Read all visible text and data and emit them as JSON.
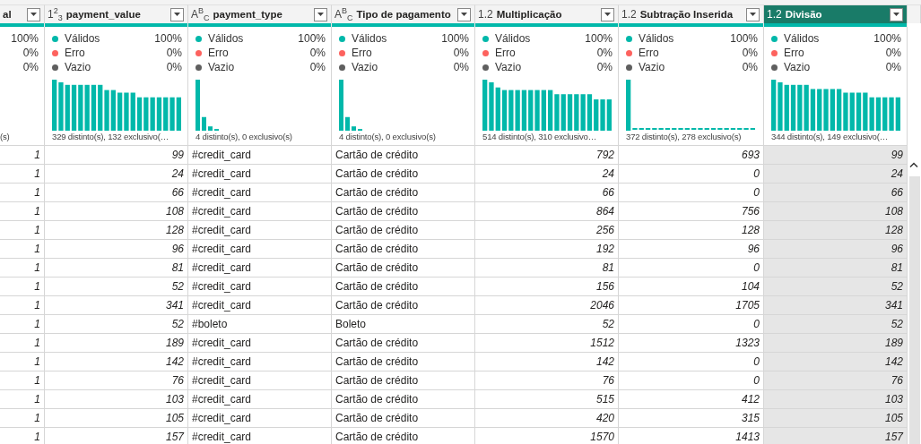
{
  "columns": [
    {
      "name": "al",
      "kind": "number",
      "selected": false,
      "quality": [
        {
          "value": "100%"
        },
        {
          "value": "0%"
        },
        {
          "value": "0%"
        }
      ],
      "summary": "(s)"
    },
    {
      "name": "payment_value",
      "kind": "number",
      "type_icon": "1$^{2}$$_{3}$",
      "selected": false,
      "quality": [
        {
          "label": "Válidos",
          "value": "100%",
          "color": "#01b8aa"
        },
        {
          "label": "Erro",
          "value": "0%",
          "color": "#fd625e"
        },
        {
          "label": "Vazio",
          "value": "0%",
          "color": "#5f5f5f"
        }
      ],
      "summary": "329 distinto(s), 132 exclusivo(…"
    },
    {
      "name": "payment_type",
      "kind": "text",
      "type_icon": "A$^{B}$$_{C}$",
      "selected": false,
      "quality": [
        {
          "label": "Válidos",
          "value": "100%",
          "color": "#01b8aa"
        },
        {
          "label": "Erro",
          "value": "0%",
          "color": "#fd625e"
        },
        {
          "label": "Vazio",
          "value": "0%",
          "color": "#5f5f5f"
        }
      ],
      "summary": "4 distinto(s), 0 exclusivo(s)"
    },
    {
      "name": "Tipo de pagamento",
      "kind": "text",
      "type_icon": "A$^{B}$$_{C}$",
      "selected": false,
      "quality": [
        {
          "label": "Válidos",
          "value": "100%",
          "color": "#01b8aa"
        },
        {
          "label": "Erro",
          "value": "0%",
          "color": "#fd625e"
        },
        {
          "label": "Vazio",
          "value": "0%",
          "color": "#5f5f5f"
        }
      ],
      "summary": "4 distinto(s), 0 exclusivo(s)"
    },
    {
      "name": "Multiplicação",
      "kind": "number",
      "type_icon": "1.2",
      "selected": false,
      "quality": [
        {
          "label": "Válidos",
          "value": "100%",
          "color": "#01b8aa"
        },
        {
          "label": "Erro",
          "value": "0%",
          "color": "#fd625e"
        },
        {
          "label": "Vazio",
          "value": "0%",
          "color": "#5f5f5f"
        }
      ],
      "summary": "514 distinto(s), 310 exclusivo…"
    },
    {
      "name": "Subtração Inserida",
      "kind": "number",
      "type_icon": "1.2",
      "selected": false,
      "quality": [
        {
          "label": "Válidos",
          "value": "100%",
          "color": "#01b8aa"
        },
        {
          "label": "Erro",
          "value": "0%",
          "color": "#fd625e"
        },
        {
          "label": "Vazio",
          "value": "0%",
          "color": "#5f5f5f"
        }
      ],
      "summary": "372 distinto(s), 278 exclusivo(s)"
    },
    {
      "name": "Divisão",
      "kind": "number",
      "type_icon": "1.2",
      "selected": true,
      "quality": [
        {
          "label": "Válidos",
          "value": "100%",
          "color": "#01b8aa"
        },
        {
          "label": "Erro",
          "value": "0%",
          "color": "#fd625e"
        },
        {
          "label": "Vazio",
          "value": "0%",
          "color": "#5f5f5f"
        }
      ],
      "summary": "344 distinto(s), 149 exclusivo(…"
    }
  ],
  "rows": [
    [
      "1",
      "99",
      "#credit_card",
      "Cartão de crédito",
      "792",
      "693",
      "99"
    ],
    [
      "1",
      "24",
      "#credit_card",
      "Cartão de crédito",
      "24",
      "0",
      "24"
    ],
    [
      "1",
      "66",
      "#credit_card",
      "Cartão de crédito",
      "66",
      "0",
      "66"
    ],
    [
      "1",
      "108",
      "#credit_card",
      "Cartão de crédito",
      "864",
      "756",
      "108"
    ],
    [
      "1",
      "128",
      "#credit_card",
      "Cartão de crédito",
      "256",
      "128",
      "128"
    ],
    [
      "1",
      "96",
      "#credit_card",
      "Cartão de crédito",
      "192",
      "96",
      "96"
    ],
    [
      "1",
      "81",
      "#credit_card",
      "Cartão de crédito",
      "81",
      "0",
      "81"
    ],
    [
      "1",
      "52",
      "#credit_card",
      "Cartão de crédito",
      "156",
      "104",
      "52"
    ],
    [
      "1",
      "341",
      "#credit_card",
      "Cartão de crédito",
      "2046",
      "1705",
      "341"
    ],
    [
      "1",
      "52",
      "#boleto",
      "Boleto",
      "52",
      "0",
      "52"
    ],
    [
      "1",
      "189",
      "#credit_card",
      "Cartão de crédito",
      "1512",
      "1323",
      "189"
    ],
    [
      "1",
      "142",
      "#credit_card",
      "Cartão de crédito",
      "142",
      "0",
      "142"
    ],
    [
      "1",
      "76",
      "#credit_card",
      "Cartão de crédito",
      "76",
      "0",
      "76"
    ],
    [
      "1",
      "103",
      "#credit_card",
      "Cartão de crédito",
      "515",
      "412",
      "103"
    ],
    [
      "1",
      "105",
      "#credit_card",
      "Cartão de crédito",
      "420",
      "315",
      "105"
    ],
    [
      "1",
      "157",
      "#credit_card",
      "Cartão de crédito",
      "1570",
      "1413",
      "157"
    ]
  ]
}
